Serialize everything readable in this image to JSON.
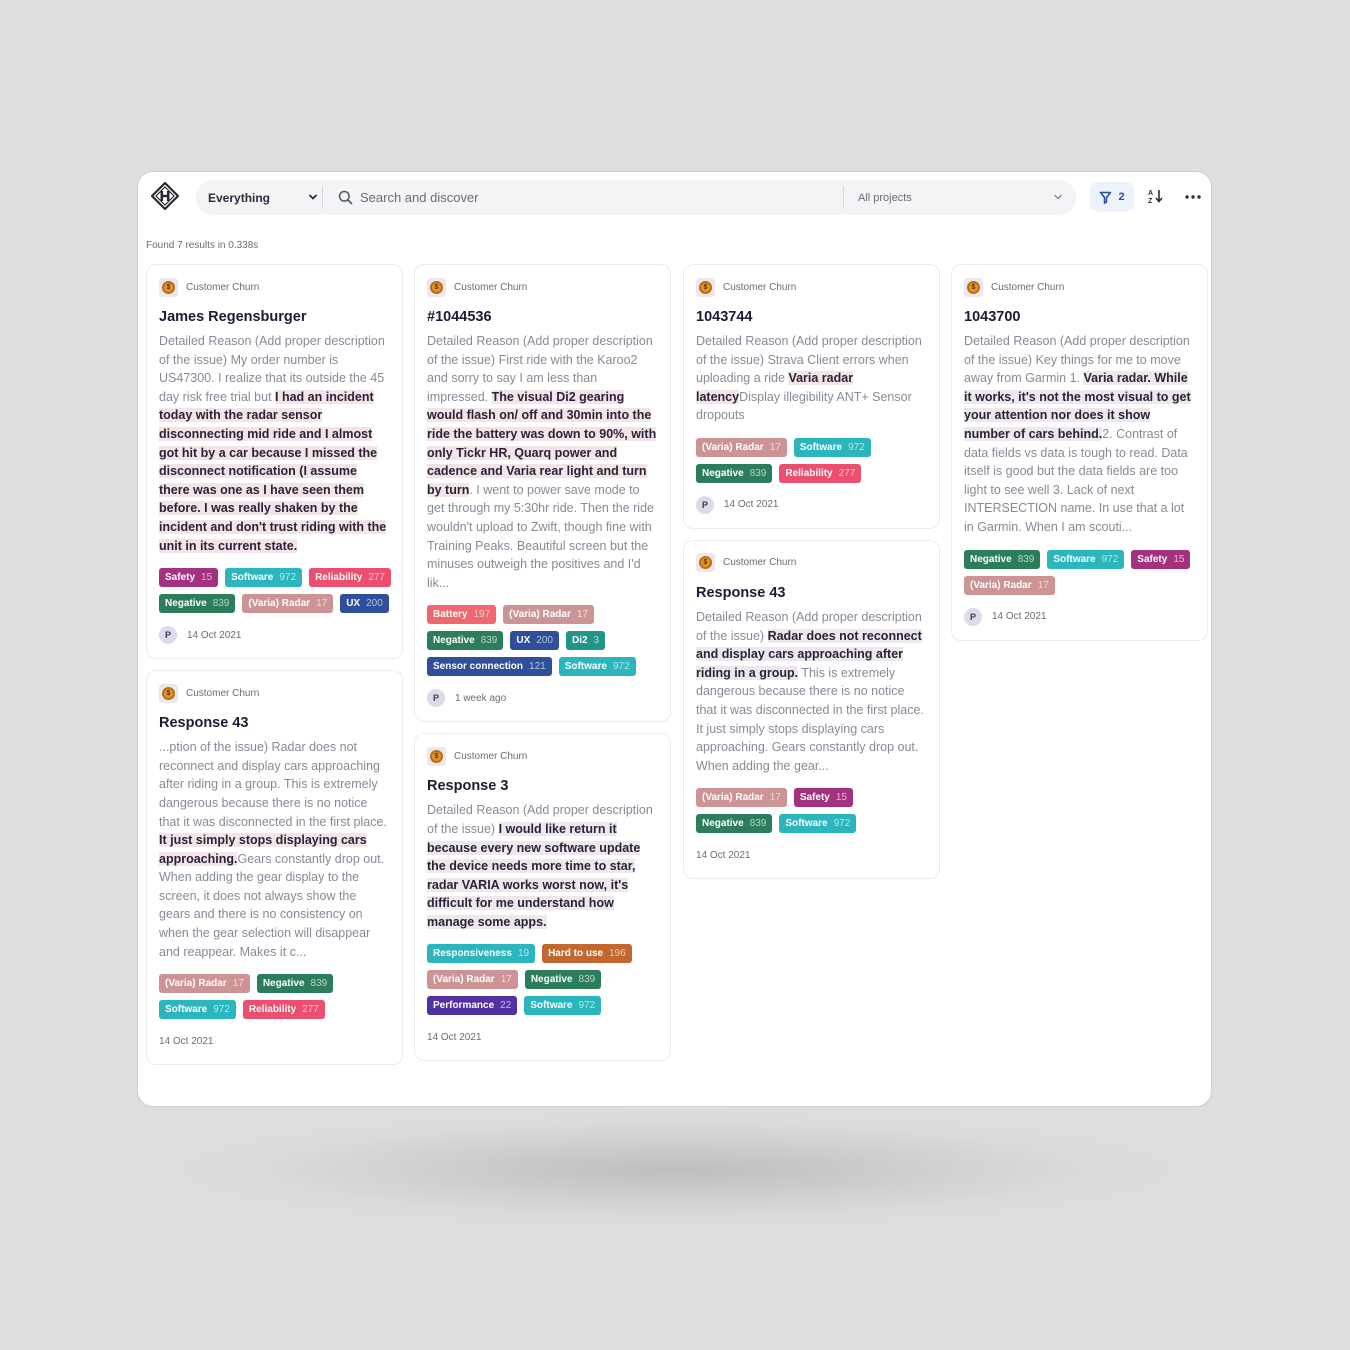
{
  "toolbar": {
    "scope_label": "Everything",
    "search_placeholder": "Search and discover",
    "projects_label": "All projects",
    "filter_count": "2"
  },
  "results": {
    "summary": "Found 7 results in 0.338s"
  },
  "tag_colors": {
    "Safety": "#a3317f",
    "Software": "#2bb5bd",
    "Reliability": "#ec4e6f",
    "Negative": "#2c7d5c",
    "(Varia) Radar": "#cc9495",
    "UX": "#2f4f9b",
    "Battery": "#f0676e",
    "Di2": "#21958c",
    "Sensor connection": "#2f4f9b",
    "Responsiveness": "#2bb5bd",
    "Hard to use": "#c2672d",
    "Performance": "#5232a2"
  },
  "cards": [
    {
      "project": "Customer Churn",
      "title": "James Regensburger",
      "segments": [
        {
          "t": "Detailed Reason (Add proper description of the issue) My order number is US47300. I realize that its outside the 45 day risk free trial but ",
          "h": ""
        },
        {
          "t": "I had an incident today with the radar sensor disconnecting mid ride and I almost got hit by a car because I missed the disconnect notification (I assume there was one as I have seen them before. I was really shaken by the incident and don't trust riding with the unit in its current state.",
          "h": "hl"
        }
      ],
      "tags": [
        {
          "label": "Safety",
          "count": "15"
        },
        {
          "label": "Software",
          "count": "972"
        },
        {
          "label": "Reliability",
          "count": "277"
        },
        {
          "label": "Negative",
          "count": "839"
        },
        {
          "label": "(Varia) Radar",
          "count": "17"
        },
        {
          "label": "UX",
          "count": "200"
        }
      ],
      "avatar": "P",
      "date": "14 Oct 2021"
    },
    {
      "project": "Customer Churn",
      "title": "Response 43",
      "segments": [
        {
          "t": "...ption of the issue) Radar does not reconnect and display cars approaching after riding in a group. This is extremely dangerous because there is no notice that it was disconnected in the first place. ",
          "h": ""
        },
        {
          "t": "It just simply stops displaying cars approaching.",
          "h": "hl"
        },
        {
          "t": "Gears constantly drop out. When adding the gear display to the screen, it does not always show the gears and there is no consistency on when the gear selection will disappear and reappear. Makes it c...",
          "h": ""
        }
      ],
      "tags": [
        {
          "label": "(Varia) Radar",
          "count": "17"
        },
        {
          "label": "Negative",
          "count": "839"
        },
        {
          "label": "Software",
          "count": "972"
        },
        {
          "label": "Reliability",
          "count": "277"
        }
      ],
      "avatar": "",
      "date": "14 Oct 2021"
    },
    {
      "project": "Customer Churn",
      "title": "#1044536",
      "segments": [
        {
          "t": "Detailed Reason (Add proper description of the issue) First ride with the Karoo2 and sorry to say I am less than impressed. ",
          "h": ""
        },
        {
          "t": "The visual Di2 gearing would flash on/ off and 30min into the ride the battery was down to 90%, with only Tickr HR, Quarq power and cadence and Varia rear light and turn by turn",
          "h": "hl"
        },
        {
          "t": ". I went to power save mode to get through my 5:30hr ride. Then the ride wouldn't upload to Zwift, though fine with Training Peaks. Beautiful screen but the minuses outweigh the positives and I'd lik...",
          "h": ""
        }
      ],
      "tags": [
        {
          "label": "Battery",
          "count": "197"
        },
        {
          "label": "(Varia) Radar",
          "count": "17"
        },
        {
          "label": "Negative",
          "count": "839"
        },
        {
          "label": "UX",
          "count": "200"
        },
        {
          "label": "Di2",
          "count": "3"
        },
        {
          "label": "Sensor connection",
          "count": "121"
        },
        {
          "label": "Software",
          "count": "972"
        }
      ],
      "avatar": "P",
      "date": "1 week ago"
    },
    {
      "project": "Customer Churn",
      "title": "Response 3",
      "segments": [
        {
          "t": "Detailed Reason (Add proper description of the issue) ",
          "h": ""
        },
        {
          "t": "I would like return it because every new software update the device needs more time to star, radar VARIA works worst now, it's difficult for me understand how manage some apps.",
          "h": "hlg"
        }
      ],
      "tags": [
        {
          "label": "Responsiveness",
          "count": "19"
        },
        {
          "label": "Hard to use",
          "count": "196"
        },
        {
          "label": "(Varia) Radar",
          "count": "17"
        },
        {
          "label": "Negative",
          "count": "839"
        },
        {
          "label": "Performance",
          "count": "22"
        },
        {
          "label": "Software",
          "count": "972"
        }
      ],
      "avatar": "",
      "date": "14 Oct 2021"
    },
    {
      "project": "Customer Churn",
      "title": "1043744",
      "segments": [
        {
          "t": "Detailed Reason (Add proper description of the issue) Strava Client errors when uploading a ride ",
          "h": ""
        },
        {
          "t": "Varia radar latency",
          "h": "hl"
        },
        {
          "t": "Display illegibility ANT+ Sensor dropouts",
          "h": ""
        }
      ],
      "tags": [
        {
          "label": "(Varia) Radar",
          "count": "17"
        },
        {
          "label": "Software",
          "count": "972"
        },
        {
          "label": "Negative",
          "count": "839"
        },
        {
          "label": "Reliability",
          "count": "277"
        }
      ],
      "avatar": "P",
      "date": "14 Oct 2021"
    },
    {
      "project": "Customer Churn",
      "title": "Response 43",
      "segments": [
        {
          "t": "Detailed Reason (Add proper description of the issue) ",
          "h": ""
        },
        {
          "t": "Radar does not reconnect and display cars approaching after riding in a group.",
          "h": "hlg"
        },
        {
          "t": " This is extremely dangerous because there is no notice that it was disconnected in the first place. It just simply stops displaying cars approaching. Gears constantly drop out. When adding the gear...",
          "h": ""
        }
      ],
      "tags": [
        {
          "label": "(Varia) Radar",
          "count": "17"
        },
        {
          "label": "Safety",
          "count": "15"
        },
        {
          "label": "Negative",
          "count": "839"
        },
        {
          "label": "Software",
          "count": "972"
        }
      ],
      "avatar": "",
      "date": "14 Oct 2021"
    },
    {
      "project": "Customer Churn",
      "title": "1043700",
      "segments": [
        {
          "t": "Detailed Reason (Add proper description of the issue) Key things for me to move away from Garmin 1. ",
          "h": ""
        },
        {
          "t": "Varia radar. While it works, it's not the most visual to get your attention nor does it show number of cars behind.",
          "h": "hlg"
        },
        {
          "t": "2. Contrast of data fields vs data is tough to read. Data itself is good but the data fields are too light to see well 3. Lack of next INTERSECTION name. In use that a lot in Garmin. When I am scouti...",
          "h": ""
        }
      ],
      "tags": [
        {
          "label": "Negative",
          "count": "839"
        },
        {
          "label": "Software",
          "count": "972"
        },
        {
          "label": "Safety",
          "count": "15"
        },
        {
          "label": "(Varia) Radar",
          "count": "17"
        }
      ],
      "avatar": "P",
      "date": "14 Oct 2021"
    }
  ],
  "columns": [
    [
      0,
      1
    ],
    [
      2,
      3
    ],
    [
      4,
      5
    ],
    [
      6
    ]
  ]
}
